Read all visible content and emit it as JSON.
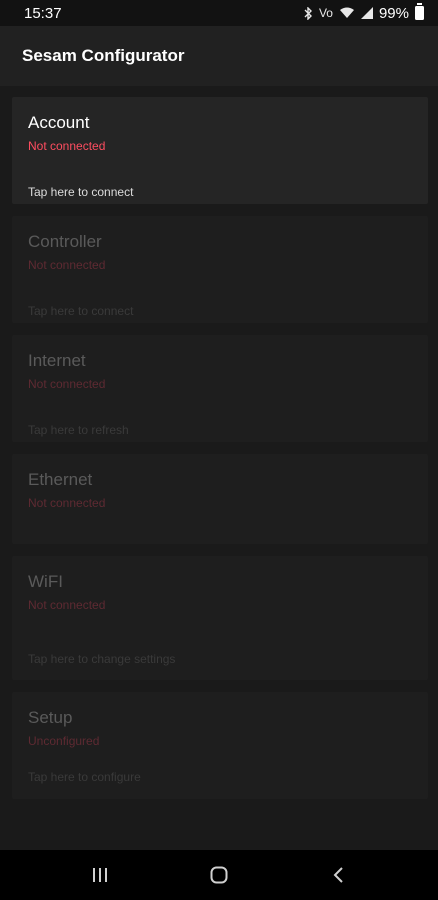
{
  "status_bar": {
    "time": "15:37",
    "battery": "99%",
    "icons": [
      "bluetooth-icon",
      "volte-icon",
      "wifi-icon",
      "signal-icon",
      "battery-icon"
    ]
  },
  "app_bar": {
    "title": "Sesam Configurator"
  },
  "cards": [
    {
      "title": "Account",
      "status": "Not connected",
      "action": "Tap here to connect"
    },
    {
      "title": "Controller",
      "status": "Not connected",
      "action": "Tap here to connect"
    },
    {
      "title": "Internet",
      "status": "Not connected",
      "action": "Tap here to refresh"
    },
    {
      "title": "Ethernet",
      "status": "Not connected"
    },
    {
      "title": "WiFI",
      "status": "Not connected",
      "action": "Tap here to change settings"
    },
    {
      "title": "Setup",
      "status": "Unconfigured",
      "action": "Tap here to configure"
    }
  ],
  "nav_bar": {
    "buttons": [
      "recents-icon",
      "home-icon",
      "back-icon"
    ]
  },
  "colors": {
    "accent_error": "#ff4d60",
    "background": "#1a1a1a",
    "card": "#252525"
  }
}
